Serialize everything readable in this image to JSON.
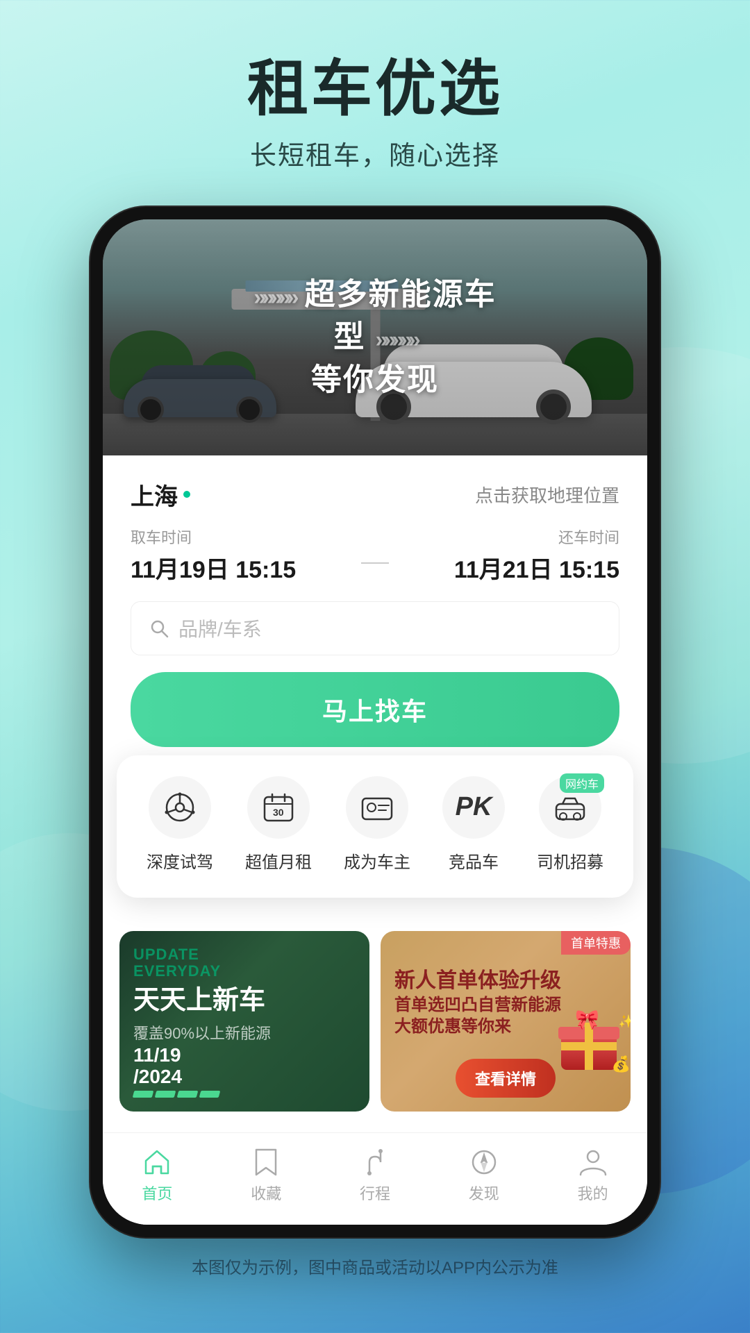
{
  "header": {
    "main_title": "租车优选",
    "sub_title": "长短租车，随心选择"
  },
  "banner": {
    "line1": "超多新能源车型",
    "line2": "等你发现"
  },
  "booking": {
    "location": "上海",
    "location_action": "点击获取地理位置",
    "pickup_label": "取车时间",
    "pickup_value": "11月19日 15:15",
    "return_label": "还车时间",
    "return_value": "11月21日 15:15",
    "search_placeholder": "品牌/车系",
    "find_car_btn": "马上找车"
  },
  "quick_menu": {
    "items": [
      {
        "label": "深度试驾",
        "icon": "steering"
      },
      {
        "label": "超值月租",
        "icon": "calendar"
      },
      {
        "label": "成为车主",
        "icon": "person-card"
      },
      {
        "label": "竞品车",
        "icon": "pk"
      },
      {
        "label": "司机招募",
        "icon": "taxi",
        "badge": "网约车"
      }
    ]
  },
  "promo_cards": [
    {
      "type": "green",
      "update_text": "UPDATE\nEVERYDAY",
      "main_title": "天天上新车",
      "sub_text": "覆盖90%以上新能源",
      "date": "11/19\n/2024"
    },
    {
      "type": "red",
      "badge": "首单特惠",
      "main_title": "新人首单体验升级",
      "sub_title": "首单选凹凸自营新能源\n大额优惠等你来",
      "btn_label": "查看详情"
    }
  ],
  "bottom_nav": {
    "items": [
      {
        "label": "首页",
        "active": true,
        "icon": "home"
      },
      {
        "label": "收藏",
        "active": false,
        "icon": "bookmark"
      },
      {
        "label": "行程",
        "active": false,
        "icon": "route"
      },
      {
        "label": "发现",
        "active": false,
        "icon": "compass"
      },
      {
        "label": "我的",
        "active": false,
        "icon": "person"
      }
    ]
  },
  "footer": {
    "disclaimer": "本图仅为示例，图中商品或活动以APP内公示为准"
  }
}
